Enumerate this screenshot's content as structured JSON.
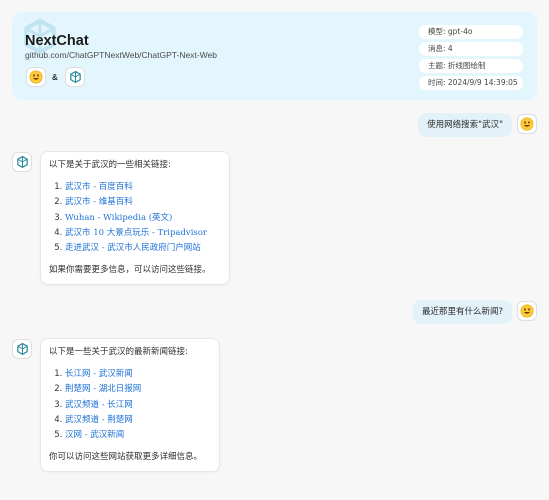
{
  "app": {
    "title": "NextChat",
    "subtitle": "github.com/ChatGPTNextWeb/ChatGPT-Next-Web",
    "amp": "&"
  },
  "meta": [
    "模型: gpt-4o",
    "消息: 4",
    "主题: 折线图绘制",
    "时间: 2024/9/9 14:39:05"
  ],
  "messages": {
    "user1": "使用网络搜索\"武汉\"",
    "bot1": {
      "intro": "以下是关于武汉的一些相关链接:",
      "links": [
        "武汉市 - 百度百科",
        "武汉市 - 维基百科",
        "Wuhan - Wikipedia (英文)",
        "武汉市 10 大景点玩乐 - Tripadvisor",
        "走进武汉 - 武汉市人民政府门户网站"
      ],
      "outro": "如果你需要更多信息，可以访问这些链接。"
    },
    "user2": "最近那里有什么新闻?",
    "bot2": {
      "intro": "以下是一些关于武汉的最新新闻链接:",
      "links": [
        "长江网 - 武汉新闻",
        "荆楚网 - 湖北日报网",
        "武汉频道 - 长江网",
        "武汉频道 - 荆楚网",
        "汉网 - 武汉新闻"
      ],
      "outro": "你可以访问这些网站获取更多详细信息。"
    }
  },
  "icons": {
    "user_avatar": "smiley-emoji-icon",
    "bot_avatar": "openai-logo-icon"
  },
  "colors": {
    "header_bg": "#e3f6fd",
    "user_bubble": "#e3f1f8",
    "link": "#1f71d6",
    "page_bg": "#f7f7f7"
  }
}
